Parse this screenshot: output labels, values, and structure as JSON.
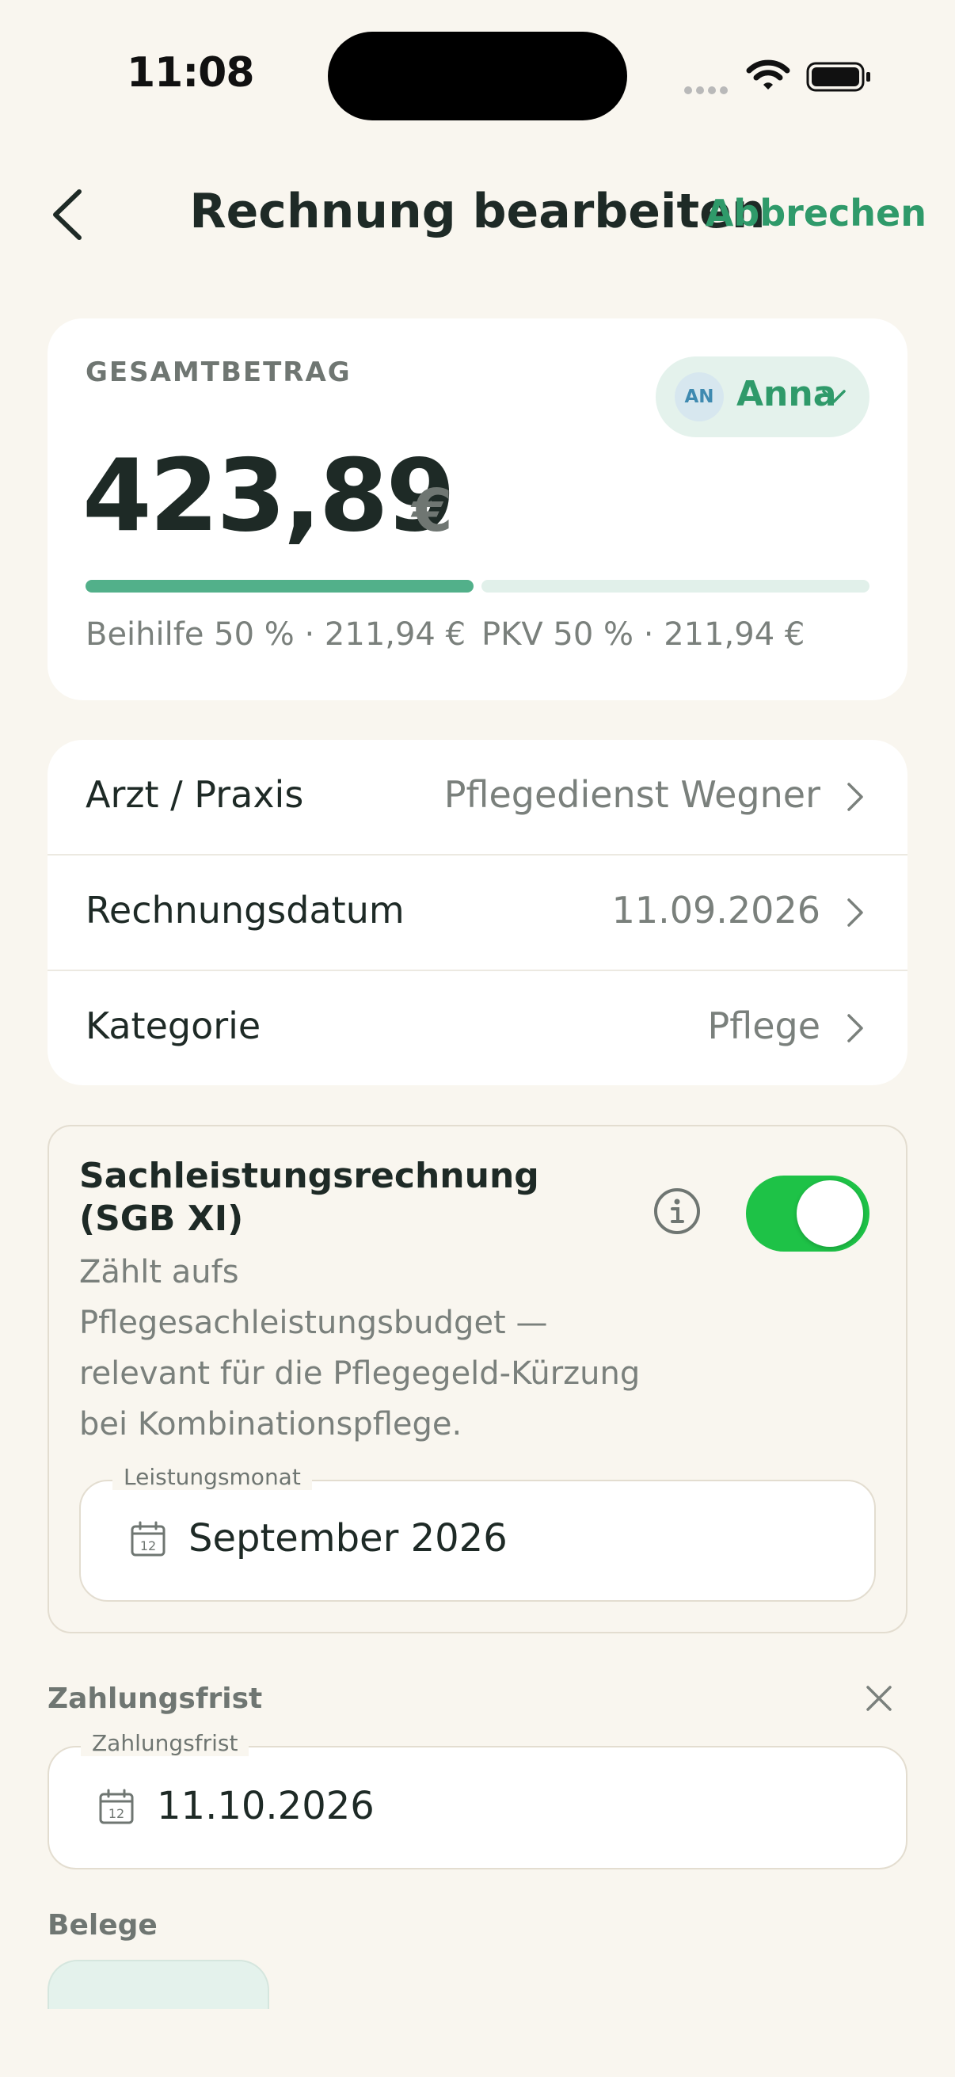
{
  "status_bar": {
    "time": "11:08"
  },
  "nav": {
    "title": "Rechnung bearbeiten",
    "cancel_label": "Abbrechen"
  },
  "total": {
    "label": "GESAMTBETRAG",
    "amount": "423,89",
    "currency": "€",
    "person": {
      "initials": "AN",
      "name": "Anna"
    },
    "split_left": "Beihilfe 50 % · 211,94 €",
    "split_right": "PKV 50 % · 211,94 €",
    "split_fraction_left": 0.5
  },
  "details": [
    {
      "label": "Arzt / Praxis",
      "value": "Pflegedienst Wegner"
    },
    {
      "label": "Rechnungsdatum",
      "value": "11.09.2026"
    },
    {
      "label": "Kategorie",
      "value": "Pflege"
    }
  ],
  "sgb": {
    "title": "Sachleistungsrechnung (SGB XI)",
    "description": "Zählt aufs Pflegesachleistungsbudget — relevant für die Pflegegeld-Kürzung bei Kombinationspflege.",
    "enabled": true,
    "month_legend": "Leistungsmonat",
    "month_value": "September 2026",
    "month_icon_day": "12"
  },
  "due": {
    "section_label": "Zahlungsfrist",
    "legend": "Zahlungsfrist",
    "value": "11.10.2026",
    "icon_day": "12"
  },
  "attachments": {
    "section_label": "Belege"
  },
  "colors": {
    "accent": "#2f9a6a",
    "toggle_on": "#1ec247",
    "background": "#f9f6ef",
    "bar_filled": "#52b08a",
    "bar_empty": "#e1f0ea"
  },
  "icons": [
    "back-chevron-icon",
    "chevron-down-icon",
    "chevron-right-icon",
    "info-icon",
    "toggle",
    "calendar-icon",
    "close-icon",
    "wifi-icon",
    "battery-icon"
  ]
}
